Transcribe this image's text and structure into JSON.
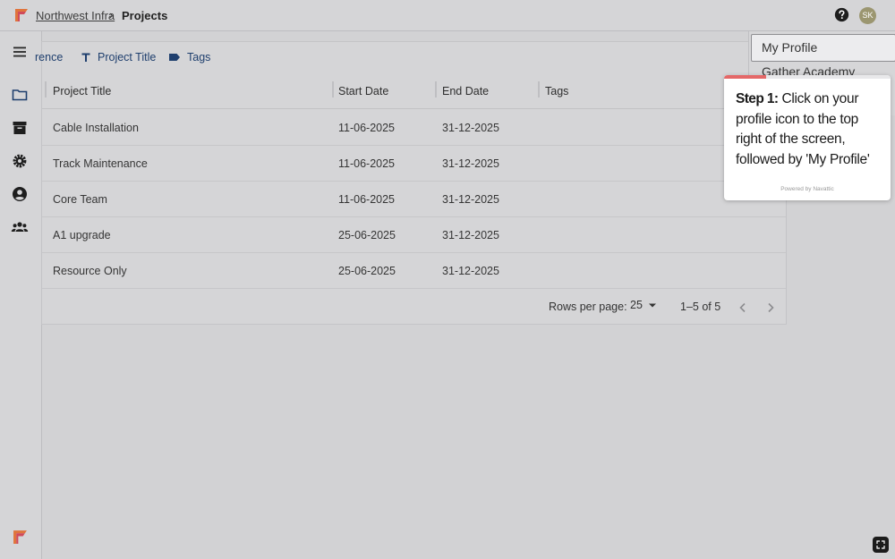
{
  "breadcrumb": {
    "org": "Northwest Infra",
    "separator": "›",
    "current": "Projects"
  },
  "header": {
    "avatar_initials": "SK"
  },
  "toolbar": {
    "items": [
      {
        "label": "rence"
      },
      {
        "label": "Project Title",
        "icon": "text-icon"
      },
      {
        "label": "Tags",
        "icon": "tag-icon"
      }
    ]
  },
  "table": {
    "columns": [
      "Project Title",
      "Start Date",
      "End Date",
      "Tags"
    ],
    "rows": [
      {
        "title": "Cable Installation",
        "start": "11-06-2025",
        "end": "31-12-2025",
        "tags": ""
      },
      {
        "title": "Track Maintenance",
        "start": "11-06-2025",
        "end": "31-12-2025",
        "tags": ""
      },
      {
        "title": "Core Team",
        "start": "11-06-2025",
        "end": "31-12-2025",
        "tags": ""
      },
      {
        "title": "A1 upgrade",
        "start": "25-06-2025",
        "end": "31-12-2025",
        "tags": ""
      },
      {
        "title": "Resource Only",
        "start": "25-06-2025",
        "end": "31-12-2025",
        "tags": ""
      }
    ]
  },
  "pagination": {
    "rows_label": "Rows per page:",
    "rows_value": "25",
    "range": "1–5 of 5"
  },
  "menu": {
    "items": [
      "My Profile",
      "Gather Academy"
    ]
  },
  "tooltip": {
    "step": "Step 1:",
    "text": "Click on your profile icon to the top right of the screen, followed by 'My Profile'",
    "powered": "Powered by Navattic",
    "progress": 0.25
  },
  "colors": {
    "accent": "#1f3f6e",
    "tooltip_progress": "#e46868",
    "avatar": "#9b9670"
  }
}
